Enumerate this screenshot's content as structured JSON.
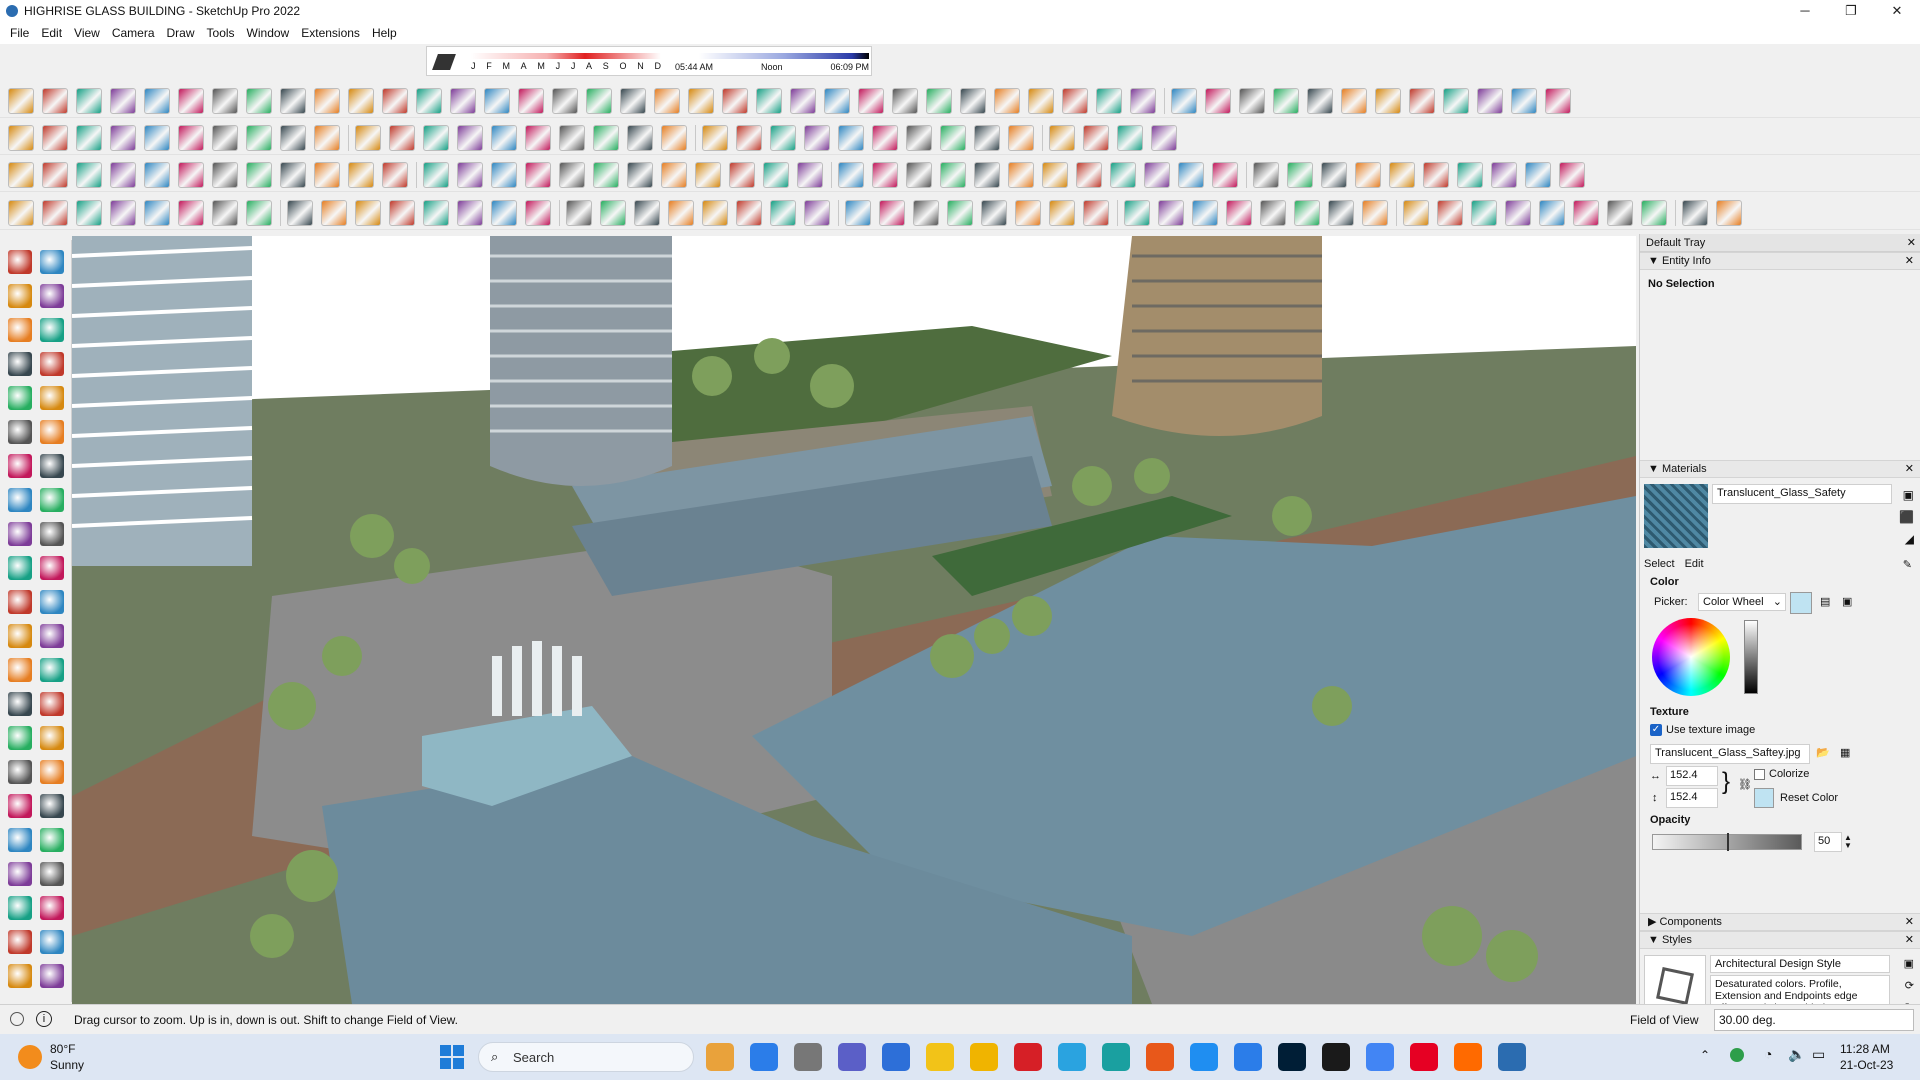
{
  "window": {
    "title": "HIGHRISE GLASS BUILDING - SketchUp Pro 2022",
    "minimize": "─",
    "maximize": "❐",
    "close": "✕"
  },
  "menu": [
    "File",
    "Edit",
    "View",
    "Camera",
    "Draw",
    "Tools",
    "Window",
    "Extensions",
    "Help"
  ],
  "shadows": {
    "months": [
      "J",
      "F",
      "M",
      "A",
      "M",
      "J",
      "J",
      "A",
      "S",
      "O",
      "N",
      "D"
    ],
    "time_start": "05:44 AM",
    "time_mid": "Noon",
    "time_end": "06:09 PM"
  },
  "tray": {
    "title": "Default Tray",
    "entity_info": {
      "header": "Entity Info",
      "selection": "No Selection"
    },
    "materials": {
      "header": "Materials",
      "material_name": "Translucent_Glass_Safety",
      "tab_select": "Select",
      "tab_edit": "Edit",
      "color_label": "Color",
      "picker_label": "Picker:",
      "picker_value": "Color Wheel",
      "texture_label": "Texture",
      "use_texture_label": "Use texture image",
      "use_texture_checked": true,
      "texture_file": "Translucent_Glass_Saftey.jpg",
      "width_value": "152.4 mm",
      "height_value": "152.4 mm",
      "colorize_label": "Colorize",
      "colorize_checked": false,
      "reset_color_label": "Reset Color",
      "opacity_label": "Opacity",
      "opacity_value": "50",
      "swatch_color": "#bfe3f2"
    },
    "components": {
      "header": "Components"
    },
    "styles": {
      "header": "Styles",
      "style_name": "Architectural Design Style",
      "style_description": "Desaturated colors. Profile, Extension and Endpoints edge effects and sky enabled."
    }
  },
  "status": {
    "hint": "Drag cursor to zoom.  Up is in, down is out. Shift to change Field of View.",
    "measure_label": "Field of View",
    "measure_value": "30.00 deg."
  },
  "taskbar": {
    "weather_temp": "80°F",
    "weather_desc": "Sunny",
    "search_placeholder": "Search",
    "time": "11:28 AM",
    "date": "21-Oct-23"
  }
}
